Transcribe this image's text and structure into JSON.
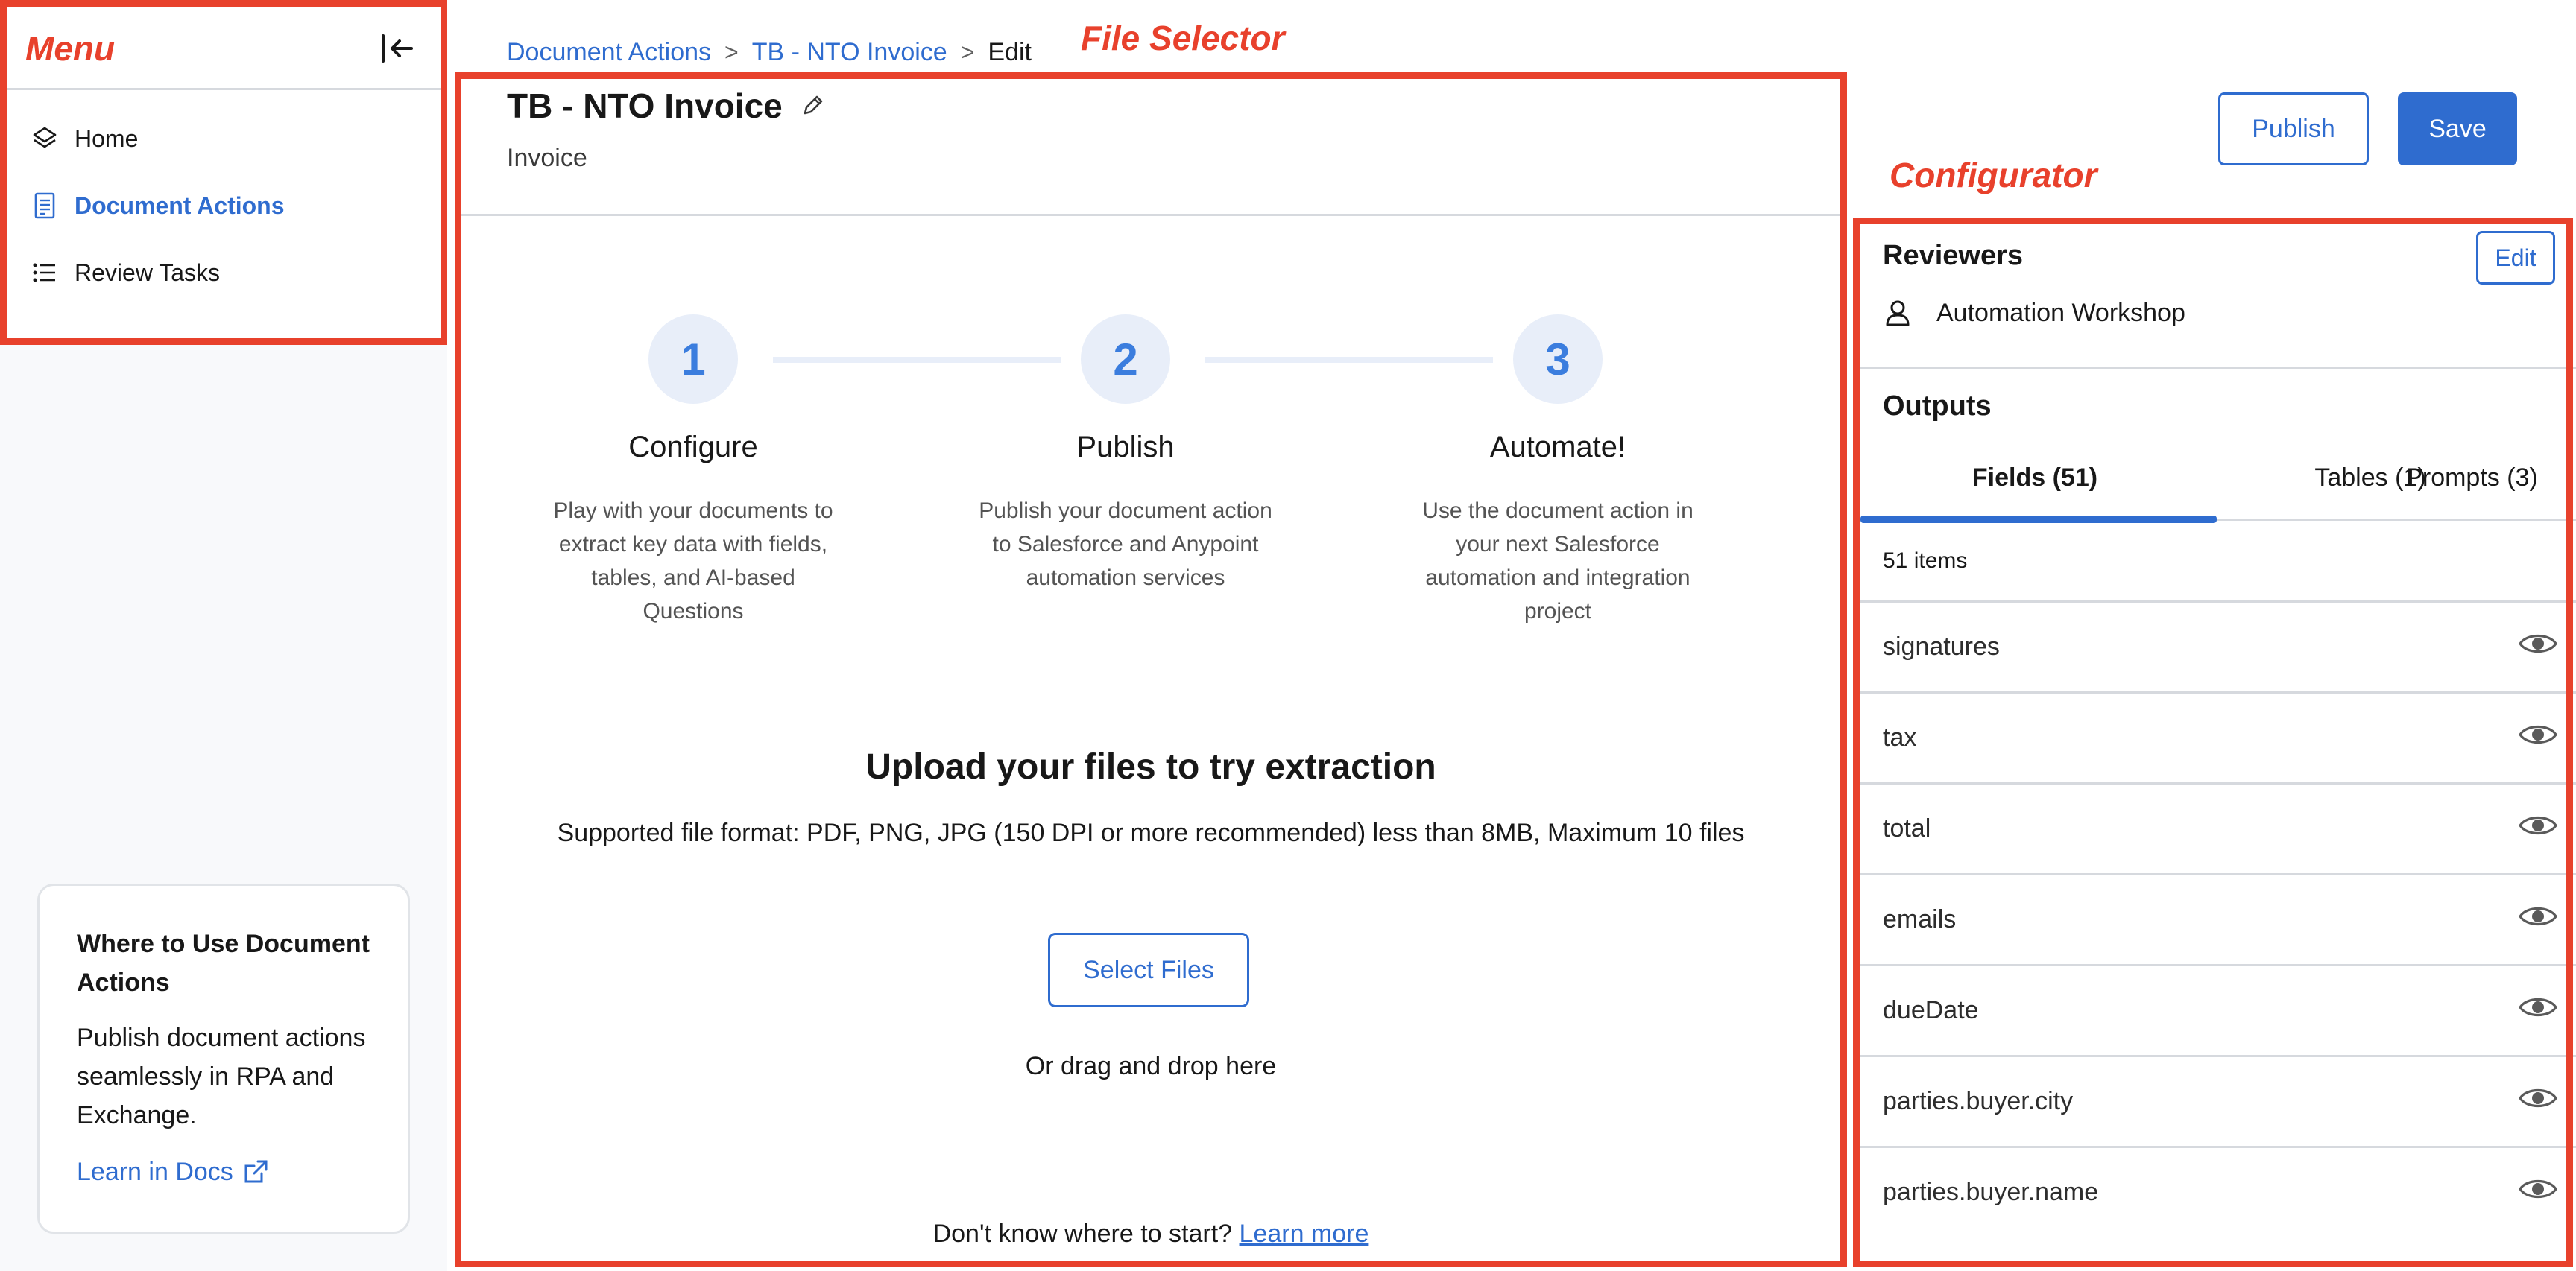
{
  "annotations": {
    "menu": "Menu",
    "file_selector": "File Selector",
    "configurator": "Configurator"
  },
  "sidebar": {
    "items": [
      {
        "label": "Home",
        "icon": "layers-icon",
        "active": false
      },
      {
        "label": "Document Actions",
        "icon": "document-icon",
        "active": true
      },
      {
        "label": "Review Tasks",
        "icon": "list-icon",
        "active": false
      }
    ],
    "info_card": {
      "title": "Where to Use Document Actions",
      "body": "Publish document actions seamlessly in RPA and Exchange.",
      "link": "Learn in Docs"
    }
  },
  "breadcrumb": {
    "items": [
      "Document Actions",
      "TB - NTO Invoice"
    ],
    "current": "Edit",
    "separator": ">"
  },
  "document": {
    "title": "TB - NTO Invoice",
    "subtitle": "Invoice"
  },
  "steps": [
    {
      "number": "1",
      "title": "Configure",
      "description": "Play with your documents to extract key data with fields, tables, and AI-based Questions"
    },
    {
      "number": "2",
      "title": "Publish",
      "description": "Publish your document action to Salesforce and Anypoint automation services"
    },
    {
      "number": "3",
      "title": "Automate!",
      "description": "Use the document action in your next Salesforce automation and integration project"
    }
  ],
  "upload": {
    "title": "Upload your files to try extraction",
    "formats": "Supported file format: PDF, PNG, JPG (150 DPI or more recommended) less than 8MB, Maximum 10 files",
    "button": "Select Files",
    "drag_text": "Or drag and drop here",
    "help_text": "Don't know where to start?",
    "help_link": "Learn more"
  },
  "actions": {
    "publish": "Publish",
    "save": "Save"
  },
  "configurator": {
    "reviewers": {
      "title": "Reviewers",
      "edit": "Edit",
      "name": "Automation Workshop"
    },
    "outputs": {
      "title": "Outputs",
      "tabs": [
        "Fields (51)",
        "Tables (1)",
        "Prompts (3)"
      ],
      "active_tab": 0,
      "count": "51 items",
      "fields": [
        "signatures",
        "tax",
        "total",
        "emails",
        "dueDate",
        "parties.buyer.city",
        "parties.buyer.name"
      ]
    }
  },
  "colors": {
    "accent": "#2f6ccf",
    "annotation": "#e8412c",
    "step_circle_bg": "#e8eef9"
  }
}
